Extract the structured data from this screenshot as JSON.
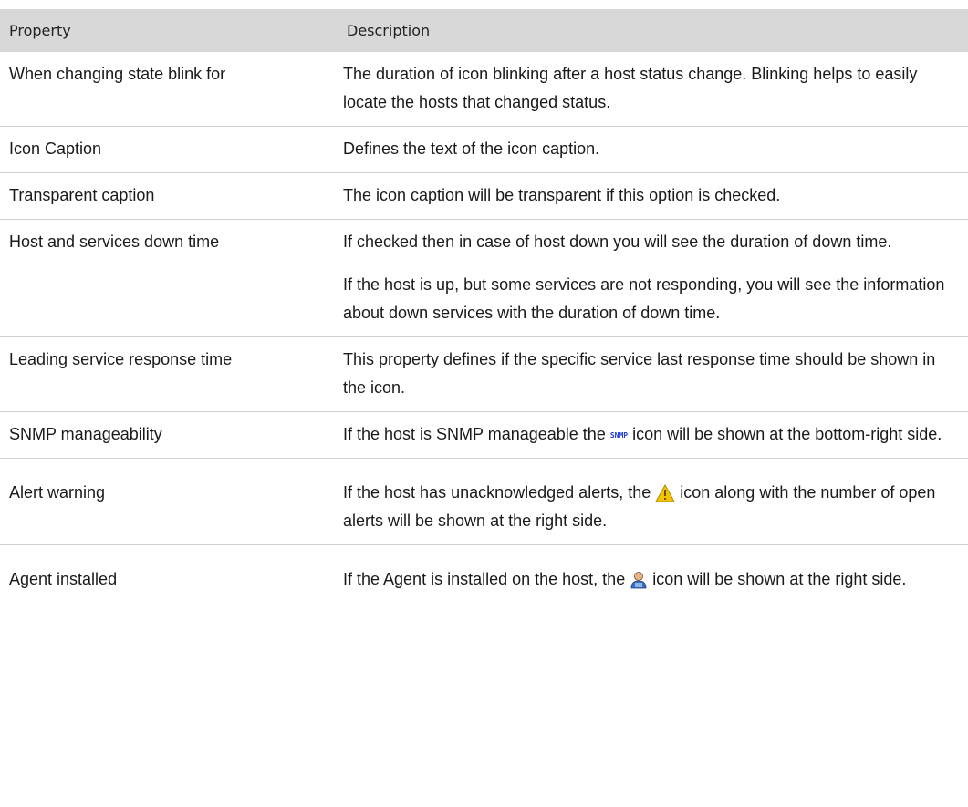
{
  "table": {
    "header": {
      "property": "Property",
      "description": "Description"
    },
    "rows": [
      {
        "property": "When changing state blink for",
        "desc": [
          "The duration of icon blinking after a host status change. Blinking helps to easily locate the hosts that changed status."
        ]
      },
      {
        "property": "Icon Caption",
        "desc": [
          "Defines the text of the icon caption."
        ]
      },
      {
        "property": "Transparent caption",
        "desc": [
          "The icon caption will be transparent if this option is checked."
        ]
      },
      {
        "property": "Host and services down time",
        "desc": [
          "If checked then in case of host down you will see the duration of down time.",
          "If the host is up, but some services are not responding, you will see the information about down services with the duration of down time."
        ]
      },
      {
        "property": "Leading service response time",
        "desc": [
          "This property defines if the specific service last response time should be shown in the icon."
        ]
      },
      {
        "property": "SNMP manageability",
        "desc_before": "If the host is SNMP manageable the",
        "icon_text": "SNMP",
        "desc_after": "icon will be shown at the bottom-right side."
      },
      {
        "property": "Alert warning",
        "desc_before": "If the host has unacknowledged alerts, the",
        "icon": "warning-triangle-icon",
        "desc_after": "icon along with the number of open alerts will be shown at the right side."
      },
      {
        "property": "Agent installed",
        "desc_before": "If the Agent is installed on the host, the",
        "icon": "agent-person-icon",
        "desc_after": "icon will be shown at the right side."
      }
    ]
  },
  "colors": {
    "header_bg": "#d8d8d8",
    "row_border": "#d2d2d2",
    "snmp_blue": "#1f3fd6",
    "warning_yellow": "#f5c400"
  }
}
